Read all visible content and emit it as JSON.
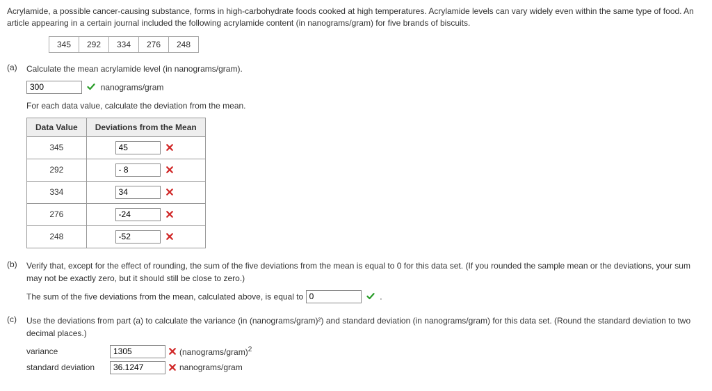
{
  "intro": "Acrylamide, a possible cancer-causing substance, forms in high-carbohydrate foods cooked at high temperatures. Acrylamide levels can vary widely even within the same type of food. An article appearing in a certain journal included the following acrylamide content (in nanograms/gram) for five brands of biscuits.",
  "data_values": [
    "345",
    "292",
    "334",
    "276",
    "248"
  ],
  "parts": {
    "a": {
      "label": "(a)",
      "q1": "Calculate the mean acrylamide level (in nanograms/gram).",
      "mean_value": "300",
      "mean_unit": "nanograms/gram",
      "q2": "For each data value, calculate the deviation from the mean.",
      "thead": {
        "c1": "Data Value",
        "c2": "Deviations from the Mean"
      },
      "rows": [
        {
          "val": "345",
          "dev": "45"
        },
        {
          "val": "292",
          "dev": "- 8"
        },
        {
          "val": "334",
          "dev": "34"
        },
        {
          "val": "276",
          "dev": "-24"
        },
        {
          "val": "248",
          "dev": "-52"
        }
      ]
    },
    "b": {
      "label": "(b)",
      "q": "Verify that, except for the effect of rounding, the sum of the five deviations from the mean is equal to 0 for this data set. (If you rounded the sample mean or the deviations, your sum may not be exactly zero, but it should still be close to zero.)",
      "stmt_prefix": "The sum of the five deviations from the mean, calculated above, is equal to",
      "sum_value": "0",
      "period": "."
    },
    "c": {
      "label": "(c)",
      "q": "Use the deviations from part (a) to calculate the variance (in (nanograms/gram)²) and standard deviation (in nanograms/gram) for this data set. (Round the standard deviation to two decimal places.)",
      "variance_label": "variance",
      "variance_value": "1305",
      "variance_unit_prefix": "(nanograms/gram)",
      "variance_unit_exp": "2",
      "sd_label": "standard deviation",
      "sd_value": "36.1247",
      "sd_unit": "nanograms/gram"
    }
  }
}
